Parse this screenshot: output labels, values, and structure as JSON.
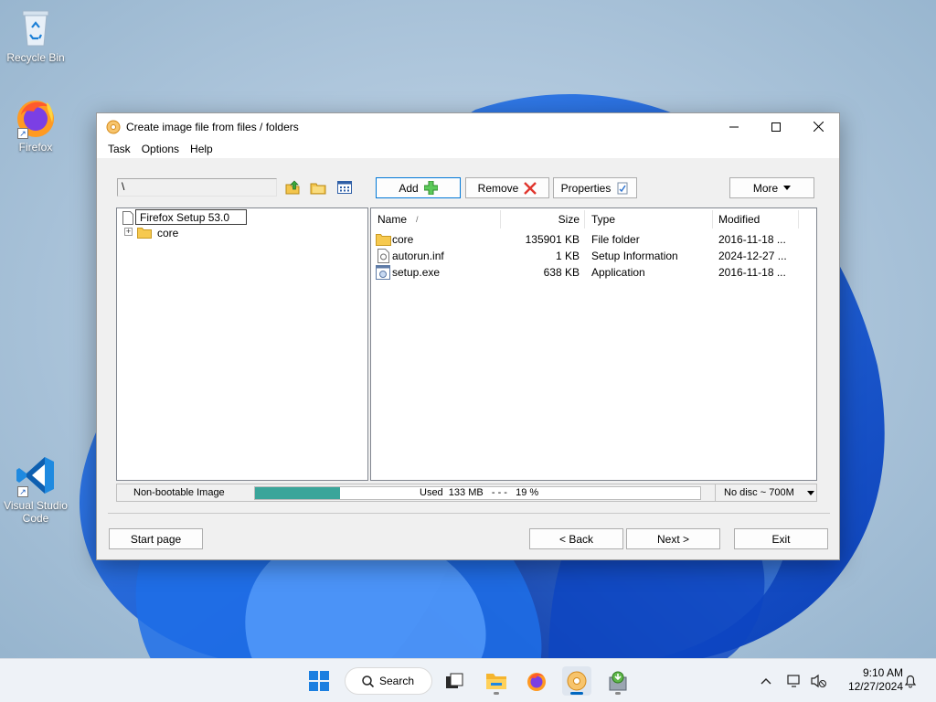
{
  "desktop": {
    "icons": [
      {
        "label": "Recycle Bin"
      },
      {
        "label": "Firefox"
      },
      {
        "label": "Visual Studio Code"
      }
    ]
  },
  "window": {
    "title": "Create image file from files / folders",
    "menu": [
      "Task",
      "Options",
      "Help"
    ],
    "path_value": "\\",
    "toolbar": {
      "add_label": "Add",
      "remove_label": "Remove",
      "properties_label": "Properties",
      "more_label": "More"
    },
    "tree": {
      "root_rename_value": "Firefox Setup 53.0",
      "items": [
        {
          "label": "core"
        }
      ]
    },
    "list": {
      "columns": {
        "name": "Name",
        "size": "Size",
        "type": "Type",
        "modified": "Modified"
      },
      "sort_indicator": "/",
      "rows": [
        {
          "name": "core",
          "size": "135901 KB",
          "type": "File folder",
          "modified": "2016-11-18 ...",
          "icon": "folder-icon"
        },
        {
          "name": "autorun.inf",
          "size": "1 KB",
          "type": "Setup Information",
          "modified": "2024-12-27 ...",
          "icon": "inf-file-icon"
        },
        {
          "name": "setup.exe",
          "size": "638 KB",
          "type": "Application",
          "modified": "2016-11-18 ...",
          "icon": "exe-file-icon"
        }
      ]
    },
    "status": {
      "boot_type": "Non-bootable Image",
      "used_text": "Used  133 MB   - - -   19 %",
      "used_percent": 19,
      "disc_select": "No disc ~ 700M"
    },
    "footer": {
      "start_page": "Start page",
      "back": "< Back",
      "next": "Next >",
      "exit": "Exit"
    }
  },
  "taskbar": {
    "search_label": "Search",
    "time": "9:10 AM",
    "date": "12/27/2024"
  },
  "colors": {
    "accent": "#0078d7",
    "progress": "#3aa59a",
    "wallpaper_blue": "#1565d8"
  }
}
